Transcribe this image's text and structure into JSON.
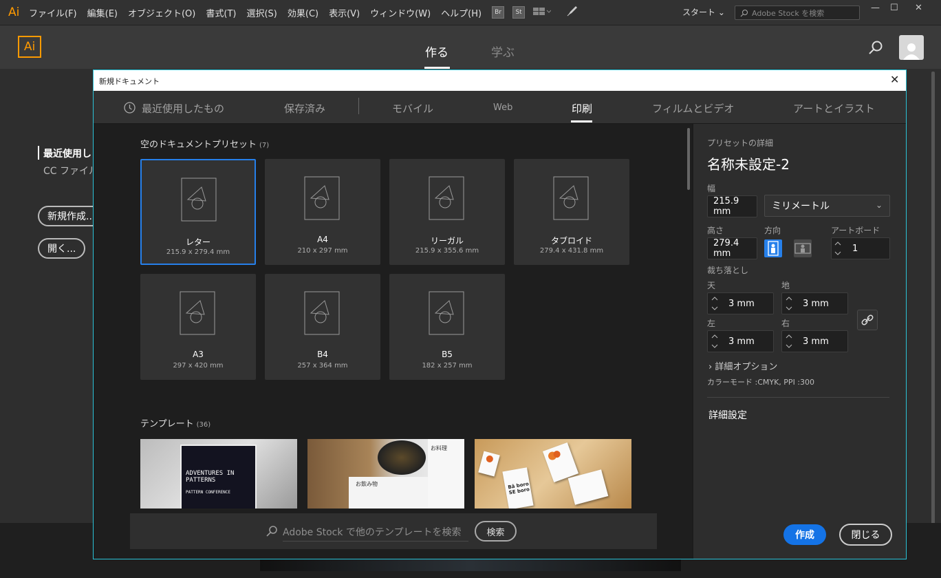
{
  "menubar": {
    "logo": "Ai",
    "items": [
      "ファイル(F)",
      "編集(E)",
      "オブジェクト(O)",
      "書式(T)",
      "選択(S)",
      "効果(C)",
      "表示(V)",
      "ウィンドウ(W)",
      "ヘルプ(H)"
    ],
    "bridge": "Br",
    "stock": "St",
    "workspace": "スタート",
    "stock_search_placeholder": "Adobe Stock を検索"
  },
  "home": {
    "logo": "Ai",
    "tabs": [
      "作る",
      "学ぶ"
    ],
    "side_recent": "最近使用し",
    "side_cc": "CC ファイル",
    "new_button": "新規作成...",
    "open_button": "開く..."
  },
  "dialog": {
    "title": "新規ドキュメント",
    "tabs": [
      "最近使用したもの",
      "保存済み",
      "モバイル",
      "Web",
      "印刷",
      "フィルムとビデオ",
      "アートとイラスト"
    ],
    "active_tab": "印刷",
    "blank_presets_title": "空のドキュメントプリセット",
    "blank_presets_count": "(7)",
    "presets": [
      {
        "name": "レター",
        "size": "215.9 x 279.4 mm"
      },
      {
        "name": "A4",
        "size": "210 x 297 mm"
      },
      {
        "name": "リーガル",
        "size": "215.9 x 355.6 mm"
      },
      {
        "name": "タブロイド",
        "size": "279.4 x 431.8 mm"
      },
      {
        "name": "A3",
        "size": "297 x 420 mm"
      },
      {
        "name": "B4",
        "size": "257 x 364 mm"
      },
      {
        "name": "B5",
        "size": "182 x 257 mm"
      }
    ],
    "templates_title": "テンプレート",
    "templates_count": "(36)",
    "template1_title": "ADVENTURES IN PATTERNS",
    "template1_sub": "PATTERN CONFERENCE",
    "template2_text": "お飲み物",
    "template2_text2": "お料理",
    "template3_text": "Bâ boro SE boro",
    "search_placeholder": "Adobe Stock で他のテンプレートを検索",
    "search_button": "検索",
    "details": {
      "header": "プリセットの詳細",
      "name": "名称未設定-2",
      "width_label": "幅",
      "width_value": "215.9 mm",
      "unit": "ミリメートル",
      "height_label": "高さ",
      "height_value": "279.4 mm",
      "orientation_label": "方向",
      "artboards_label": "アートボード",
      "artboards_value": "1",
      "bleed_label": "裁ち落とし",
      "top_label": "天",
      "top_value": "3 mm",
      "bottom_label": "地",
      "bottom_value": "3 mm",
      "left_label": "左",
      "left_value": "3 mm",
      "right_label": "右",
      "right_value": "3 mm",
      "advanced_options": "詳細オプション",
      "color_mode": "カラーモード :CMYK, PPI :300",
      "more_settings": "詳細設定",
      "create_button": "作成",
      "close_button": "閉じる"
    }
  },
  "colors": {
    "accent_blue": "#1473e6",
    "selected_border": "#2680eb",
    "ai_orange": "#ff9a00",
    "dialog_border": "#2ac3d8"
  }
}
